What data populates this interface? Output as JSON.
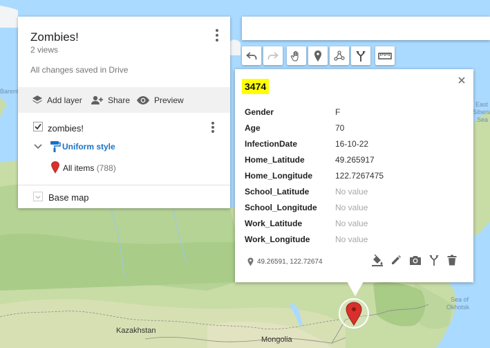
{
  "map": {
    "labels": {
      "barents": "Barents",
      "east_siberian": "East",
      "east_siberian2": "Siberian",
      "east_siberian3": "Sea",
      "sea_of": "Sea of",
      "okhotsk": "Okhotsk",
      "kazakhstan": "Kazakhstan",
      "mongolia": "Mongolia"
    }
  },
  "map_panel": {
    "title": "Zombies!",
    "views": "2 views",
    "saved_status": "All changes saved in Drive",
    "actions": {
      "add_layer": "Add layer",
      "share": "Share",
      "preview": "Preview"
    },
    "layer": {
      "name": "zombies!",
      "checked": true,
      "style_label": "Uniform style",
      "items_label": "All items",
      "items_count": "(788)"
    },
    "base_map_label": "Base map"
  },
  "search": {
    "placeholder": ""
  },
  "toolbar": {
    "tools": [
      "undo-icon",
      "redo-icon",
      "hand-pan-icon",
      "add-marker-icon",
      "draw-line-icon",
      "directions-icon",
      "measure-ruler-icon"
    ]
  },
  "popup": {
    "title": "3474",
    "fields": [
      {
        "name": "Gender",
        "value": "F"
      },
      {
        "name": "Age",
        "value": "70"
      },
      {
        "name": "InfectionDate",
        "value": "16-10-22"
      },
      {
        "name": "Home_Latitude",
        "value": "49.265917"
      },
      {
        "name": "Home_Longitude",
        "value": "122.7267475"
      },
      {
        "name": "School_Latitude",
        "value": "No value"
      },
      {
        "name": "School_Longitude",
        "value": "No value"
      },
      {
        "name": "Work_Latitude",
        "value": "No value"
      },
      {
        "name": "Work_Longitude",
        "value": "No value"
      }
    ],
    "coords": "49.26591, 122.72674",
    "actions": [
      "paint-bucket-icon",
      "edit-pencil-icon",
      "camera-icon",
      "directions-icon",
      "trash-icon"
    ]
  },
  "colors": {
    "water": "#aadaff",
    "land": "#c4dba4",
    "accent_blue": "#1a73c8",
    "marker_red": "#d8312b",
    "highlight": "#ffff00"
  }
}
